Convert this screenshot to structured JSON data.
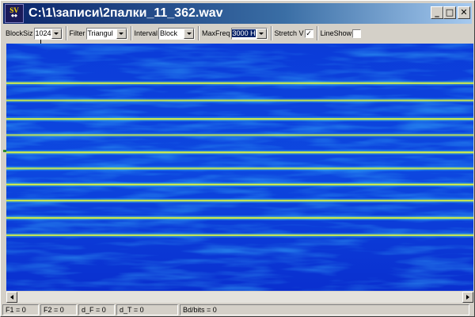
{
  "window": {
    "title": "C:\\1\\записи\\2палки_11_362.wav",
    "logo_text": "SV",
    "controls": [
      "minimize-icon",
      "maximize-icon",
      "close-icon"
    ]
  },
  "toolbar": {
    "blocksize": {
      "label": "BlockSiz",
      "value": "1024"
    },
    "filter": {
      "label": "Filter",
      "value": "Triangul"
    },
    "interval": {
      "label": "Interval",
      "value": "Block"
    },
    "maxfreq": {
      "label": "MaxFreq",
      "value": "3000 H"
    },
    "stretch": {
      "label": "Stretch V",
      "checked": true,
      "mark": "✓"
    },
    "lineshow": {
      "label": "LineShow",
      "checked": false
    }
  },
  "spectrogram": {
    "background": "#0a2fcf",
    "line_color": "#c8e850",
    "lines": [
      {
        "position": 0.16,
        "strength": 0.9
      },
      {
        "position": 0.23,
        "strength": 0.7
      },
      {
        "position": 0.305,
        "strength": 1.0
      },
      {
        "position": 0.37,
        "strength": 0.6
      },
      {
        "position": 0.44,
        "strength": 1.0
      },
      {
        "position": 0.505,
        "strength": 0.8
      },
      {
        "position": 0.57,
        "strength": 1.0
      },
      {
        "position": 0.635,
        "strength": 0.9
      },
      {
        "position": 0.705,
        "strength": 1.0
      },
      {
        "position": 0.775,
        "strength": 0.85
      }
    ]
  },
  "status": {
    "f1": "F1 = 0",
    "f2": "F2 = 0",
    "df": "d_F = 0",
    "dt": "d_T = 0",
    "bd": "Bd/bits = 0"
  }
}
